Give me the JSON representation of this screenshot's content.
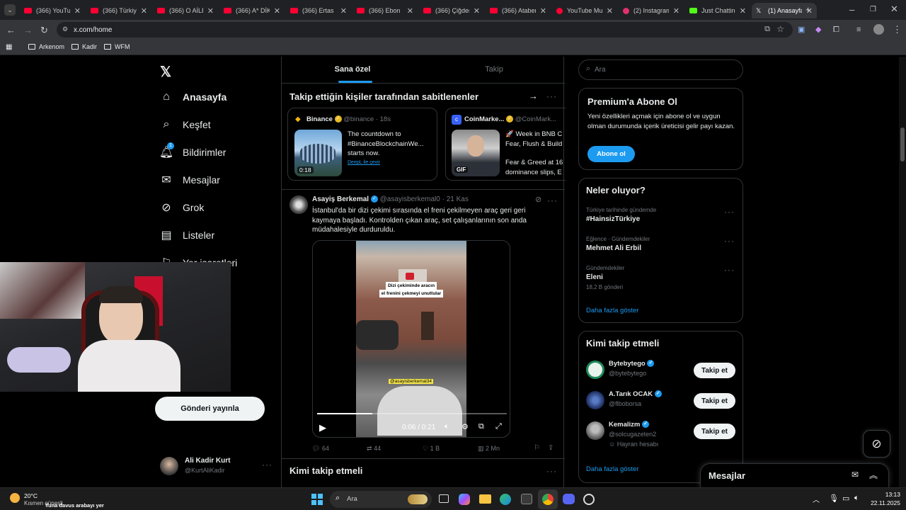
{
  "browser": {
    "tabs": [
      {
        "title": "(366) YouTube",
        "type": "youtube"
      },
      {
        "title": "(366) Türkiye",
        "type": "youtube"
      },
      {
        "title": "(366) O AİLE",
        "type": "youtube"
      },
      {
        "title": "(366) A* DİK",
        "type": "youtube"
      },
      {
        "title": "(366) Ertas",
        "type": "youtube"
      },
      {
        "title": "(366) Ebon",
        "type": "youtube"
      },
      {
        "title": "(366) Çiğdem",
        "type": "youtube"
      },
      {
        "title": "(366) Ataber",
        "type": "youtube"
      },
      {
        "title": "YouTube Mu",
        "type": "ytmusic"
      },
      {
        "title": "(2) Instagram",
        "type": "instagram"
      },
      {
        "title": "Just Chatting",
        "type": "kick"
      },
      {
        "title": "(1) Anasayfa",
        "type": "x"
      }
    ],
    "url": "x.com/home",
    "bookmarks": [
      "Arkenom",
      "Kadir",
      "WFM"
    ]
  },
  "sidebar": {
    "nav": [
      {
        "label": "Anasayfa",
        "icon": "home-icon"
      },
      {
        "label": "Keşfet",
        "icon": "search-icon"
      },
      {
        "label": "Bildirimler",
        "icon": "bell-icon"
      },
      {
        "label": "Mesajlar",
        "icon": "mail-icon"
      },
      {
        "label": "Grok",
        "icon": "grok-icon"
      },
      {
        "label": "Listeler",
        "icon": "list-icon"
      },
      {
        "label": "Yer işaretleri",
        "icon": "bookmark-icon"
      }
    ],
    "notification_count": "1",
    "post_button": "Gönderi yayınla",
    "account": {
      "name": "Ali Kadir Kurt",
      "handle": "@KurtAliKadir"
    }
  },
  "feed": {
    "tabs": [
      "Sana özel",
      "Takip"
    ],
    "pinned_section_title": "Takip ettiğin kişiler tarafından sabitlenenler",
    "pinned": [
      {
        "name": "Binance",
        "handle": "@binance",
        "time": "18s",
        "text": "The countdown to #BinanceBlockchainWe... starts now.",
        "duration": "0:18",
        "translate": "DeepL ile çevir"
      },
      {
        "name": "CoinMarke...",
        "handle": "@CoinMark...",
        "text1": "🚀 Week in BNB C",
        "text2": "Fear, Flush & Build",
        "text3": "Fear & Greed at 16",
        "text4": "dominance slips, E",
        "badge": "GIF"
      }
    ],
    "post": {
      "name": "Asayiş Berkemal",
      "handle": "@asayisberkemal0",
      "time": "21 Kas",
      "text": "İstanbul'da bir dizi çekimi sırasında el freni çekilmeyen araç geri geri kaymaya başladı. Kontrolden çıkan araç, set çalışanlarının son anda müdahalesiyle durduruldu.",
      "overlay_line1": "Dizi çekiminde aracın",
      "overlay_line2": "el frenini çekmeyi unuttular",
      "watermark": "@asayisberkemal34",
      "video_time": "0:06 / 0:21",
      "progress": 0.29,
      "stats": {
        "replies": "64",
        "reposts": "44",
        "likes": "1 B",
        "views": "2 Mn"
      }
    },
    "who_to_follow_title": "Kimi takip etmeli"
  },
  "right": {
    "search_placeholder": "Ara",
    "premium": {
      "title": "Premium'a Abone Ol",
      "text": "Yeni özellikleri açmak için abone ol ve uygun olman durumunda içerik üreticisi gelir payı kazan.",
      "button": "Abone ol"
    },
    "trends_title": "Neler oluyor?",
    "trends": [
      {
        "meta": "Türkiye tarihinde gündemde",
        "name": "#HainsizTürkiye",
        "count": ""
      },
      {
        "meta": "Eğlence · Gündemdekiler",
        "name": "Mehmet Ali Erbil",
        "count": ""
      },
      {
        "meta": "Gündemdekiler",
        "name": "Eleni",
        "count": "18,2 B gönderi"
      }
    ],
    "show_more": "Daha fazla göster",
    "follow_title": "Kimi takip etmeli",
    "follow": [
      {
        "name": "Bytebytego",
        "handle": "@bytebytego",
        "note": ""
      },
      {
        "name": "A.Tarık OCAK",
        "handle": "@flboborsa",
        "note": ""
      },
      {
        "name": "Kemalizm",
        "handle": "@solcugazeten2",
        "note": "Hayran hesabı"
      }
    ],
    "follow_button": "Takip et",
    "follow_show_more": "Daha fazla göster",
    "messages_label": "Mesajlar"
  },
  "taskbar": {
    "weather_temp": "20°C",
    "weather_desc": "Kısmen güneşli",
    "ticker": "Tuna davus arabayı yer",
    "search": "Ara",
    "time": "13:13",
    "date": "22.11.2025"
  },
  "colors": {
    "accent": "#1d9bf0",
    "background": "#000000",
    "chrome": "#202124"
  }
}
